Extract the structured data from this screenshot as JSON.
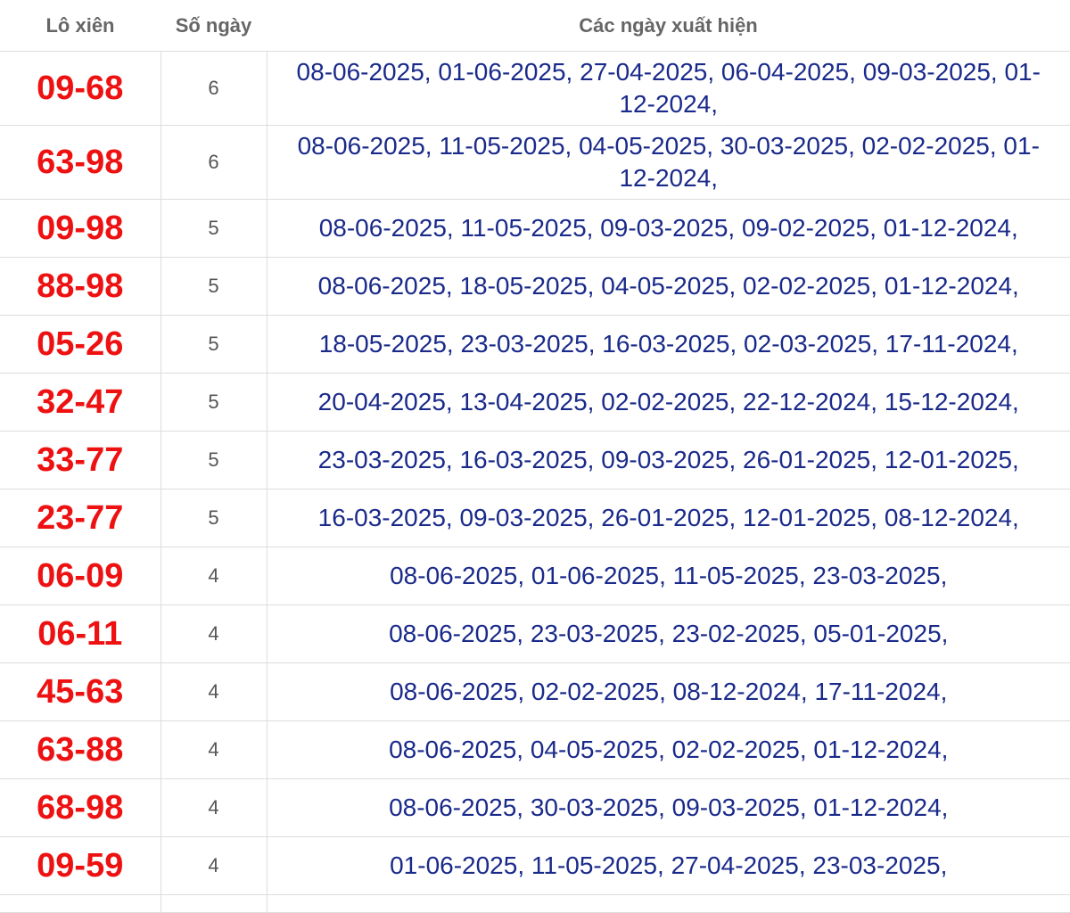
{
  "table": {
    "headers": {
      "pair": "Lô xiên",
      "count": "Số ngày",
      "dates": "Các ngày xuất hiện"
    },
    "rows": [
      {
        "pair": "09-68",
        "count": "6",
        "dates": "08-06-2025, 01-06-2025, 27-04-2025, 06-04-2025, 09-03-2025, 01-12-2024,"
      },
      {
        "pair": "63-98",
        "count": "6",
        "dates": "08-06-2025, 11-05-2025, 04-05-2025, 30-03-2025, 02-02-2025, 01-12-2024,"
      },
      {
        "pair": "09-98",
        "count": "5",
        "dates": "08-06-2025, 11-05-2025, 09-03-2025, 09-02-2025, 01-12-2024,"
      },
      {
        "pair": "88-98",
        "count": "5",
        "dates": "08-06-2025, 18-05-2025, 04-05-2025, 02-02-2025, 01-12-2024,"
      },
      {
        "pair": "05-26",
        "count": "5",
        "dates": "18-05-2025, 23-03-2025, 16-03-2025, 02-03-2025, 17-11-2024,"
      },
      {
        "pair": "32-47",
        "count": "5",
        "dates": "20-04-2025, 13-04-2025, 02-02-2025, 22-12-2024, 15-12-2024,"
      },
      {
        "pair": "33-77",
        "count": "5",
        "dates": "23-03-2025, 16-03-2025, 09-03-2025, 26-01-2025, 12-01-2025,"
      },
      {
        "pair": "23-77",
        "count": "5",
        "dates": "16-03-2025, 09-03-2025, 26-01-2025, 12-01-2025, 08-12-2024,"
      },
      {
        "pair": "06-09",
        "count": "4",
        "dates": "08-06-2025, 01-06-2025, 11-05-2025, 23-03-2025,"
      },
      {
        "pair": "06-11",
        "count": "4",
        "dates": "08-06-2025, 23-03-2025, 23-02-2025, 05-01-2025,"
      },
      {
        "pair": "45-63",
        "count": "4",
        "dates": "08-06-2025, 02-02-2025, 08-12-2024, 17-11-2024,"
      },
      {
        "pair": "63-88",
        "count": "4",
        "dates": "08-06-2025, 04-05-2025, 02-02-2025, 01-12-2024,"
      },
      {
        "pair": "68-98",
        "count": "4",
        "dates": "08-06-2025, 30-03-2025, 09-03-2025, 01-12-2024,"
      },
      {
        "pair": "09-59",
        "count": "4",
        "dates": "01-06-2025, 11-05-2025, 27-04-2025, 23-03-2025,"
      }
    ]
  },
  "colors": {
    "pair": "#ee1111",
    "dates": "#1a2a8a",
    "count": "#555555",
    "header": "#666666",
    "border": "#dddddd"
  }
}
